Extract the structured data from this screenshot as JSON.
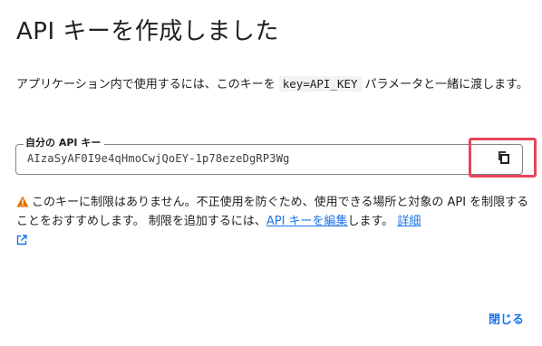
{
  "dialog": {
    "title": "API キーを作成しました",
    "description_before": "アプリケーション内で使用するには、このキーを",
    "description_code": "key=API_KEY",
    "description_after": "パラメータと一緒に渡します。",
    "key_label": "自分の API キー",
    "key_value": "AIzaSyAF0I9e4qHmoCwjQoEY-1p78ezeDgRP3Wg",
    "warning_text": "このキーに制限はありません。不正使用を防ぐため、使用できる場所と対象の API を制限することをおすすめします。 制限を追加するには、",
    "warning_link": "API キーを編集",
    "warning_after": "します。",
    "details_link": "詳細",
    "close_label": "閉じる"
  },
  "icons": {
    "copy": "copy-icon",
    "warning": "warning-icon",
    "external_link": "external-link-icon"
  },
  "colors": {
    "link": "#1a73e8",
    "warning": "#e37400",
    "highlight": "#e8455b"
  }
}
